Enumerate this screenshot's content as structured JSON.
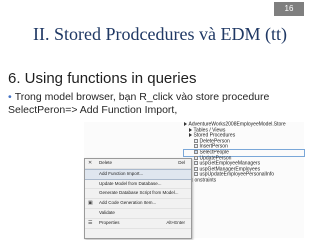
{
  "slide": {
    "number": "16",
    "title": "II. Stored Prodcedures và EDM (tt)",
    "subtitle": "6. Using functions in queries",
    "bullet_symbol": "•",
    "bullet_text": "Trong model browser, bạn R_click vào store procedure SelectPeron=> Add Function Import,"
  },
  "tree": {
    "items": [
      {
        "label": "AdventureWorks2008EmployeeModel.Store",
        "depth": 0,
        "expand": true,
        "selected": false
      },
      {
        "label": "Tables / Views",
        "depth": 1,
        "expand": true,
        "selected": false
      },
      {
        "label": "Stored Procedures",
        "depth": 1,
        "expand": true,
        "selected": false
      },
      {
        "label": "DeletePerson",
        "depth": 2,
        "expand": false,
        "selected": false
      },
      {
        "label": "InsertPerson",
        "depth": 2,
        "expand": false,
        "selected": false
      },
      {
        "label": "SelectPeople",
        "depth": 2,
        "expand": false,
        "selected": true
      },
      {
        "label": "UpdatePerson",
        "depth": 2,
        "expand": false,
        "selected": false
      },
      {
        "label": "uspGetEmployeeManagers",
        "depth": 2,
        "expand": false,
        "selected": false
      },
      {
        "label": "uspGetManagerEmployees",
        "depth": 2,
        "expand": false,
        "selected": false
      },
      {
        "label": "uspUpdateEmployeePersonalInfo",
        "depth": 2,
        "expand": false,
        "selected": false
      },
      {
        "label": "onstraints",
        "depth": 1,
        "expand": false,
        "selected": false
      }
    ]
  },
  "context_menu": {
    "items": [
      {
        "label": "Delete",
        "shortcut": "Del",
        "icon": "✕",
        "highlighted": false
      },
      {
        "label": "Add Function Import...",
        "shortcut": "",
        "icon": "",
        "highlighted": true
      },
      {
        "label": "Update Model from Database...",
        "shortcut": "",
        "icon": "",
        "highlighted": false
      },
      {
        "label": "Generate Database Script from Model...",
        "shortcut": "",
        "icon": "",
        "highlighted": false
      },
      {
        "label": "Add Code Generation Item...",
        "shortcut": "",
        "icon": "▣",
        "highlighted": false
      },
      {
        "label": "Validate",
        "shortcut": "",
        "icon": "",
        "highlighted": false
      },
      {
        "label": "Properties",
        "shortcut": "Alt+Enter",
        "icon": "☰",
        "highlighted": false
      }
    ]
  }
}
